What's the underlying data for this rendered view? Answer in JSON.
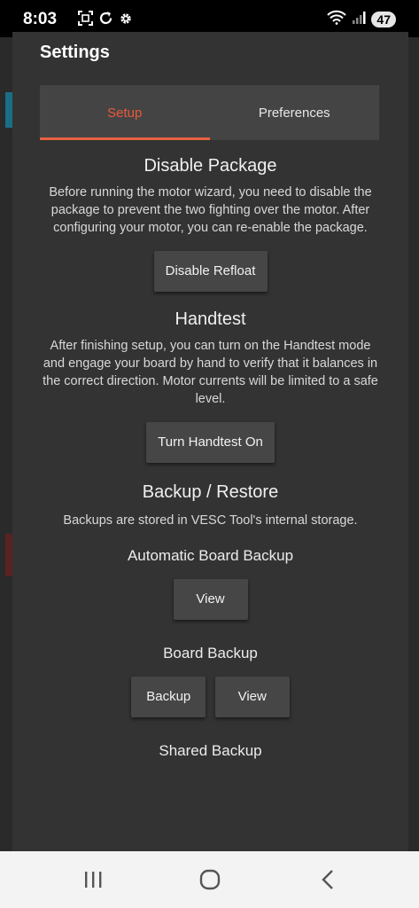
{
  "status_bar": {
    "time": "8:03",
    "battery": "47"
  },
  "dialog": {
    "title": "Settings",
    "tabs": [
      {
        "label": "Setup",
        "active": true
      },
      {
        "label": "Preferences",
        "active": false
      }
    ]
  },
  "sections": {
    "disable_package": {
      "title": "Disable Package",
      "description": "Before running the motor wizard, you need to disable the package to prevent the two fighting over the motor. After configuring your motor, you can re-enable the package.",
      "button": "Disable Refloat"
    },
    "handtest": {
      "title": "Handtest",
      "description": "After finishing setup, you can turn on the Handtest mode and engage your board by hand to verify that it balances in the correct direction. Motor currents will be limited to a safe level.",
      "button": "Turn Handtest On"
    },
    "backup_restore": {
      "title": "Backup / Restore",
      "description": "Backups are stored in VESC Tool's internal storage.",
      "automatic": {
        "title": "Automatic Board Backup",
        "view": "View"
      },
      "board": {
        "title": "Board Backup",
        "backup": "Backup",
        "view": "View"
      },
      "shared": {
        "title": "Shared Backup"
      }
    }
  },
  "colors": {
    "accent": "#e8603e",
    "dialog_bg": "#333333",
    "tab_bar_bg": "#444444",
    "button_bg": "#464646"
  },
  "icons": {
    "status": [
      "screenshot-icon",
      "sync-icon",
      "settings-gear-icon",
      "wifi-icon",
      "signal-icon"
    ],
    "nav": [
      "recent-apps-icon",
      "home-icon",
      "back-icon"
    ]
  }
}
